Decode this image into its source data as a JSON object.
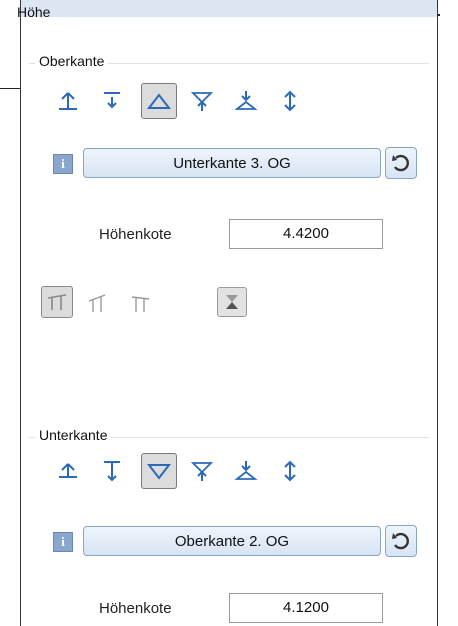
{
  "panel": {
    "title": "Höhe"
  },
  "top": {
    "group_label": "Oberkante",
    "icons": [
      "align-top-icon",
      "align-top-offset-icon",
      "triangle-up-icon",
      "attach-from-top-icon",
      "attach-to-bottom-icon",
      "vertical-adjust-icon"
    ],
    "selected_icon": "triangle-up-icon",
    "level_button": "Unterkante 3. OG",
    "height_label": "Höhenkote",
    "height_value": "4.4200"
  },
  "bottom": {
    "group_label": "Unterkante",
    "icons": [
      "align-up-icon",
      "align-bottom-icon",
      "triangle-down-icon",
      "attach-from-top-icon",
      "attach-to-bottom-icon",
      "vertical-adjust-icon"
    ],
    "selected_icon": "triangle-down-icon",
    "level_button": "Oberkante 2. OG",
    "height_label": "Höhenkote",
    "height_value": "4.1200"
  },
  "roof_tools": [
    "roof-both-icon",
    "roof-left-icon",
    "roof-right-icon",
    "hourglass-icon"
  ],
  "colors": {
    "title_bar": "#dce6f2",
    "button_border": "#8aa6c7",
    "info_icon": "#8ba6cd"
  }
}
